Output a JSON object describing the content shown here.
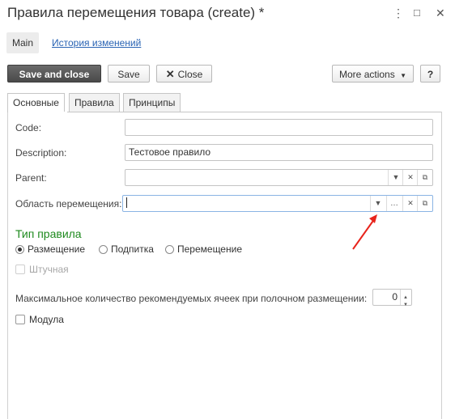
{
  "window": {
    "title": "Правила перемещения товара (create) *",
    "controls": {
      "menu": "⋮",
      "maximize": "□",
      "close": "✕"
    }
  },
  "nav": {
    "main": "Main",
    "history": "История изменений"
  },
  "toolbar": {
    "save_and_close": "Save and close",
    "save": "Save",
    "close": "Close",
    "more_actions": "More actions",
    "help": "?"
  },
  "tabs": [
    {
      "label": "Основные"
    },
    {
      "label": "Правила"
    },
    {
      "label": "Принципы"
    }
  ],
  "fields": {
    "code": {
      "label": "Code:",
      "value": ""
    },
    "description": {
      "label": "Description:",
      "value": "Тестовое правило"
    },
    "parent": {
      "label": "Parent:",
      "value": ""
    },
    "area": {
      "label": "Область перемещения:",
      "value": ""
    }
  },
  "rule_type": {
    "heading": "Тип правила",
    "options": [
      {
        "label": "Размещение",
        "selected": true
      },
      {
        "label": "Подпитка",
        "selected": false
      },
      {
        "label": "Перемещение",
        "selected": false
      }
    ]
  },
  "piece_checkbox": {
    "label": "Штучная",
    "checked": false,
    "disabled": true
  },
  "max_cells": {
    "label": "Максимальное количество рекомендуемых ячеек при полочном размещении:",
    "value": "0"
  },
  "modula_checkbox": {
    "label": "Модула",
    "checked": false
  },
  "annotation": {
    "color": "#e8241c"
  }
}
